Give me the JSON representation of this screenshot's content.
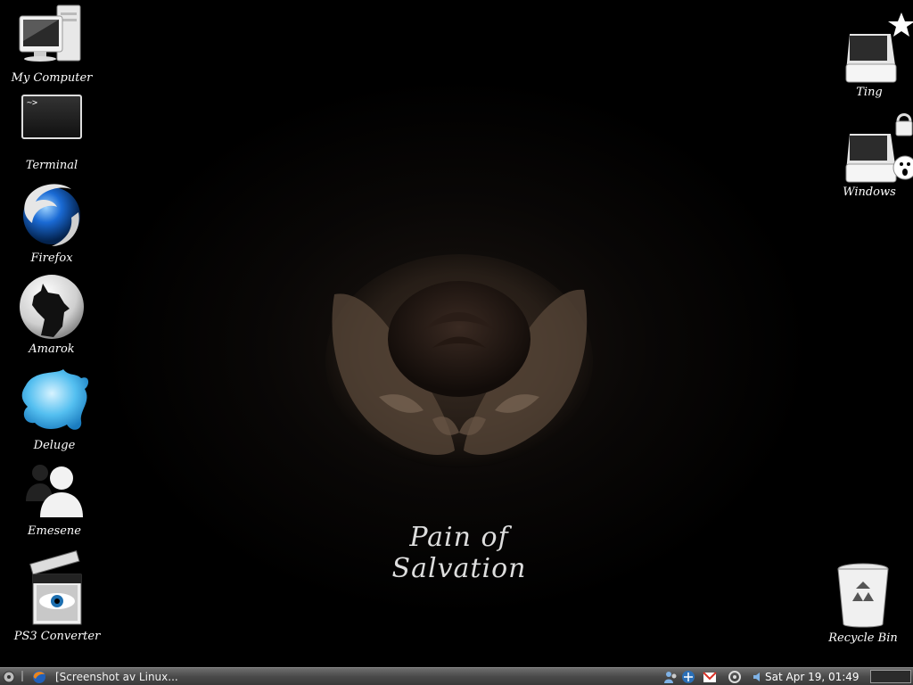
{
  "desktop": {
    "left_icons": [
      {
        "label": "My Computer"
      },
      {
        "label": "Terminal"
      },
      {
        "label": "Firefox"
      },
      {
        "label": "Amarok"
      },
      {
        "label": "Deluge"
      },
      {
        "label": "Emesene"
      },
      {
        "label": "PS3 Converter"
      }
    ],
    "right_icons": [
      {
        "label": "Ting"
      },
      {
        "label": "Windows"
      },
      {
        "label": "Recycle Bin"
      }
    ],
    "terminal_prompt": "~>",
    "wallpaper": {
      "title": "Pain of Salvation"
    }
  },
  "taskbar": {
    "window_title": "[Screenshot av Linux...",
    "clock": "Sat Apr 19, 01:49",
    "tray_icons": [
      "user-icon",
      "network-icon",
      "gmail-icon",
      "settings-icon",
      "volume-icon"
    ]
  }
}
